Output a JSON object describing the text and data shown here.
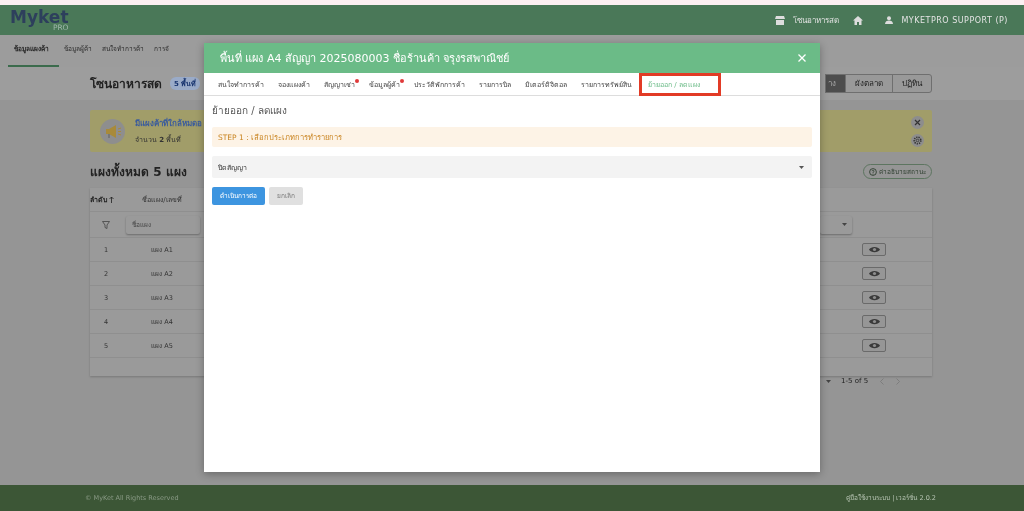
{
  "header": {
    "logo": "Myket",
    "logo_sub": "PRO",
    "zone": "โซนอาหารสด",
    "user": "MYKETPRO SUPPORT (P)"
  },
  "nav": [
    {
      "label": "ข้อมูลแผงค้า",
      "selected": true
    },
    {
      "label": "ข้อมูลผู้ค้า",
      "selected": false
    },
    {
      "label": "สนใจทำการค้า",
      "selected": false
    },
    {
      "label": "การจั",
      "selected": false
    }
  ],
  "page": {
    "title": "โซนอาหารสด",
    "badge": "5 พื้นที่",
    "view_buttons": [
      {
        "label": "าง",
        "selected": true
      },
      {
        "label": "ผังตลาด",
        "selected": false
      },
      {
        "label": "ปฏิทิน",
        "selected": false
      }
    ],
    "notice": {
      "title": "มีแผงค้าที่ใกล้หมดอ",
      "text": "จำนวน **2** พื้นที่"
    },
    "summary": "แผงทั้งหมด 5 แผง",
    "legend_button": "ค่าอธิบายสถานะ"
  },
  "table": {
    "columns": [
      "ลำดับ",
      "ชื่อแผง/เลขที่"
    ],
    "filter_placeholder": "ชื่อแผง",
    "rows": [
      {
        "no": "1",
        "name": "แผง A1"
      },
      {
        "no": "2",
        "name": "แผง A2"
      },
      {
        "no": "3",
        "name": "แผง A3"
      },
      {
        "no": "4",
        "name": "แผง A4"
      },
      {
        "no": "5",
        "name": "แผง A5"
      }
    ],
    "pagination": "1-5 of 5"
  },
  "modal": {
    "title": "พื้นที่ แผง A4 สัญญา 2025080003 ชื่อร้านค้า จรุงรสพาณิชย์",
    "tabs": [
      {
        "label": "สนใจทำการค้า",
        "dot": false,
        "selected": false
      },
      {
        "label": "จองแผงค้า",
        "dot": false,
        "selected": false
      },
      {
        "label": "สัญญาเช่า",
        "dot": true,
        "selected": false
      },
      {
        "label": "ข้อมูลผู้ค้า",
        "dot": true,
        "selected": false
      },
      {
        "label": "ประวัติพักการค้า",
        "dot": false,
        "selected": false
      },
      {
        "label": "รายการบิล",
        "dot": false,
        "selected": false
      },
      {
        "label": "มิเตอร์ดิจิตอล",
        "dot": false,
        "selected": false
      },
      {
        "label": "รายการทรัพย์สิน",
        "dot": false,
        "selected": false
      },
      {
        "label": "ย้ายออก / ลดแผง",
        "dot": false,
        "selected": true
      }
    ],
    "heading": "ย้ายออก / ลดแผง",
    "step": "STEP 1 : เลือกประเภทการทำรายการ",
    "select_value": "ปิดสัญญา",
    "buttons": [
      {
        "label": "ดำเนินการต่อ",
        "kind": "primary",
        "disabled": false
      },
      {
        "label": "ยกเลิก",
        "kind": "secondary",
        "disabled": true
      }
    ]
  },
  "footer": {
    "copyright": "© MyKet All Rights Reserved",
    "links": "คู่มือใช้งานระบบ | เวอร์ชั่น 2.0.2"
  }
}
